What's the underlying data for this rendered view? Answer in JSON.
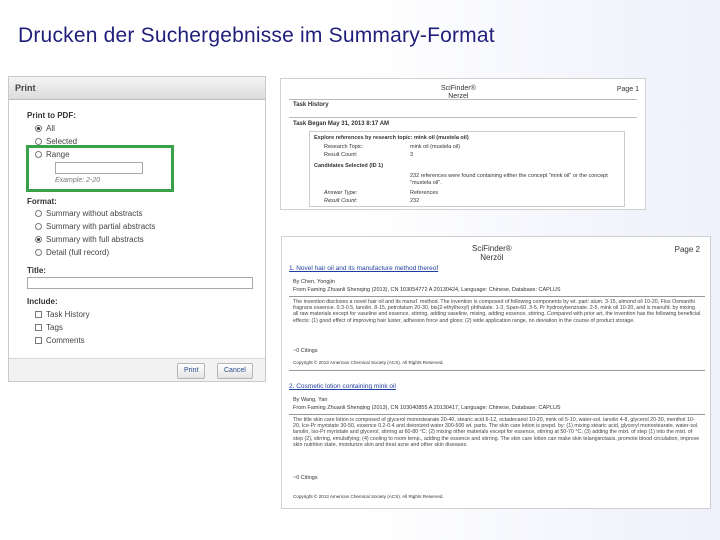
{
  "slide": {
    "title": "Drucken der Suchergebnisse im Summary-Format"
  },
  "dialog": {
    "title": "Print",
    "print_to_pdf_label": "Print to PDF:",
    "print_options": [
      {
        "label": "All",
        "selected": true
      },
      {
        "label": "Selected",
        "selected": false
      },
      {
        "label": "Range",
        "selected": false
      }
    ],
    "range_example": "Example: 2-20",
    "format_label": "Format:",
    "format_options": [
      {
        "label": "Summary without abstracts",
        "selected": false
      },
      {
        "label": "Summary with partial abstracts",
        "selected": false
      },
      {
        "label": "Summary with full abstracts",
        "selected": true
      },
      {
        "label": "Detail (full record)",
        "selected": false
      }
    ],
    "title_label": "Title:",
    "title_value": "",
    "include_label": "Include:",
    "include_options": [
      {
        "label": "Task History",
        "checked": false
      },
      {
        "label": "Tags",
        "checked": false
      },
      {
        "label": "Comments",
        "checked": false
      }
    ],
    "print_button": "Print",
    "cancel_button": "Cancel",
    "highlight_color": "#3aa04a"
  },
  "task_page": {
    "logo_line1": "SciFinder®",
    "logo_line2": "Nerzel",
    "page_number": "Page 1",
    "task_history": "Task History",
    "task_began": "Task Began May 31, 2013 8:17 AM",
    "explore_heading": "Explore references by research topic: mink oil (mustela oil)",
    "rows": [
      {
        "label": "Research Topic:",
        "value": "mink oil (mustela oil)"
      },
      {
        "label": "Result Count:",
        "value": "3"
      }
    ],
    "candidates_heading": "Candidates Selected (ID 1)",
    "candidates_text": "232 references were found containing either the concept \"mink oil\" or the concept \"mustela oil\".",
    "answer_type_label": "Answer Type:",
    "answer_type_value": "References",
    "result_count_label": "Result Count:",
    "result_count_value": "232"
  },
  "summary_page": {
    "logo_line1": "SciFinder®",
    "logo_line2": "Nerzöl",
    "page_number": "Page 2",
    "references": [
      {
        "title": "1. Novel hair oil and its manufacture method thereof",
        "author": "By Chen, Yongjin",
        "source": "From Faming Zhuanli Shenqing (2013), CN 103054772 A 20130424, Language: Chinese, Database: CAPLUS",
        "abstract": "The invention discloses a novel hair oil and its manuf. method. The invention is composed of following components by wt. part: alum. 3-15, almond oil 10-20, Flos Osmanthi fragrans essence. 0.3-0.5, lanolin. 8-15, petrolatum 20-30, bis(2-ethylhexyl) phthalate. 1-3, Span-60. 3-5, Pr hydroxybenzoate. 2-5, mink oil 10-20, and is manufd. by mixing all raw materials except for vaseline and essence, stirring, adding vaseline, mixing, adding essence, stirring. Compared with prior art, the invention has the following beneficial effects: (1) good effect of improving hair luster, adhesion force and gloss; (2) wide application range, no deviation in the course of product storage.",
        "citations": "~0 Citings",
        "copyright": "Copyright © 2013 American Chemical Society (ACS). All Rights Reserved."
      },
      {
        "title": "2. Cosmetic lotion containing mink oil",
        "author": "By Wang, Yan",
        "source": "From Faming Zhuanli Shenqing (2013), CN 103040855 A 20130417, Language: Chinese, Database: CAPLUS",
        "abstract": "The title skin care lotion is composed of glycerol monostearate 20-40, stearic acid 6-12, octadecanol 10-20, mink oil 5-10, water-sol. lanolin 4-8, glycerol 20-30, menthol 10-20, Ice-Pr myristate 30-50, essence 0.2-0.4 and deionized water 300-500 wt. parts. The skin care lotion is prepd. by: (1) mixing stearic acid, glyceryl monostearate, water-sol. lanolin, Iso-Pr myristate and glycerol, stirring at 60-80 °C; (2) mixing other materials except for essence, stirring at 50-70 °C; (3) adding the mixt. of step (1) into the mixt. of step (2), stirring, emulsifying; (4) cooling to room temp., adding the essence and stirring. The skin care lotion can make skin telangiectasis, promote blood circulation, improve skin nutrition state, moisturize skin and treat acne and other skin diseases.",
        "citations": "~0 Citings",
        "copyright": "Copyright © 2013 American Chemical Society (ACS). All Rights Reserved."
      }
    ]
  }
}
